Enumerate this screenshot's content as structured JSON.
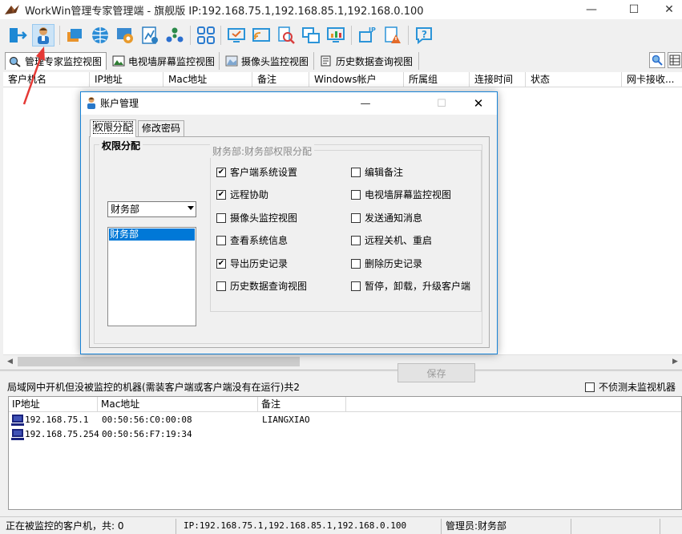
{
  "window": {
    "title": "WorkWin管理专家管理端 - 旗舰版 IP:192.168.75.1,192.168.85.1,192.168.0.100",
    "minimize": "—",
    "maximize": "☐",
    "close": "✕"
  },
  "toolbar": {
    "items": [
      {
        "name": "exit-icon",
        "color": "#1e88d4"
      },
      {
        "name": "account-icon",
        "color": "#d08a3a"
      },
      {
        "name": "windows-icon",
        "color": "#e8932c"
      },
      {
        "name": "globe-icon",
        "color": "#2b8cd6"
      },
      {
        "name": "settings-icon",
        "color": "#3a8ad0"
      },
      {
        "name": "chart-icon",
        "color": "#2c7fc2"
      },
      {
        "name": "group-icon",
        "color": "#2b8a4a"
      },
      {
        "name": "grid-icon",
        "color": "#2a7bcf"
      },
      {
        "name": "screen-icon",
        "color": "#2b94d8"
      },
      {
        "name": "cast-icon",
        "color": "#2b94d8"
      },
      {
        "name": "search-doc-icon",
        "color": "#2b94d8"
      },
      {
        "name": "copy-icon",
        "color": "#2b94d8"
      },
      {
        "name": "monitor-icon",
        "color": "#2b94d8"
      },
      {
        "name": "ip-icon",
        "color": "#2b94d8"
      },
      {
        "name": "alert-icon",
        "color": "#e36b2a"
      },
      {
        "name": "help-icon",
        "color": "#2b94d8"
      }
    ]
  },
  "tabs": [
    {
      "label": "管理专家监控视图"
    },
    {
      "label": "电视墙屏幕监控视图"
    },
    {
      "label": "摄像头监控视图"
    },
    {
      "label": "历史数据查询视图"
    }
  ],
  "grid": {
    "columns": [
      "客户机名",
      "IP地址",
      "Mac地址",
      "备注",
      "Windows帐户",
      "所属组",
      "连接时间",
      "状态",
      "网卡接收..."
    ]
  },
  "lan": {
    "title": "局域网中开机但没被监控的机器(需装客户端或客户端没有在运行)共2",
    "checkbox_label": "不侦测未监视机器",
    "columns": [
      "IP地址",
      "Mac地址",
      "备注"
    ],
    "rows": [
      {
        "ip": "192.168.75.1",
        "mac": "00:50:56:C0:00:08",
        "note": "LIANGXIAO"
      },
      {
        "ip": "192.168.75.254",
        "mac": "00:50:56:F7:19:34",
        "note": ""
      }
    ]
  },
  "status": {
    "monitored": "正在被监控的客户机，共: 0",
    "ip": "IP:192.168.75.1,192.168.85.1,192.168.0.100",
    "admin": "管理员:财务部"
  },
  "dialog": {
    "title": "账户管理",
    "tab_perm": "权限分配",
    "tab_pwd": "修改密码",
    "group_title": "权限分配",
    "combo_value": "财务部",
    "list_items": [
      "财务部"
    ],
    "perm_group_title": "财务部:财务部权限分配",
    "permissions": [
      {
        "label": "客户端系统设置",
        "checked": true
      },
      {
        "label": "编辑备注",
        "checked": false
      },
      {
        "label": "远程协助",
        "checked": true
      },
      {
        "label": "电视墙屏幕监控视图",
        "checked": false
      },
      {
        "label": "摄像头监控视图",
        "checked": false
      },
      {
        "label": "发送通知消息",
        "checked": false
      },
      {
        "label": "查看系统信息",
        "checked": false
      },
      {
        "label": "远程关机、重启",
        "checked": false
      },
      {
        "label": "导出历史记录",
        "checked": true
      },
      {
        "label": "删除历史记录",
        "checked": false
      },
      {
        "label": "历史数据查询视图",
        "checked": false
      },
      {
        "label": "暂停，卸载，升级客户端",
        "checked": false
      }
    ],
    "save_label": "保存",
    "check_mark": "✔"
  }
}
